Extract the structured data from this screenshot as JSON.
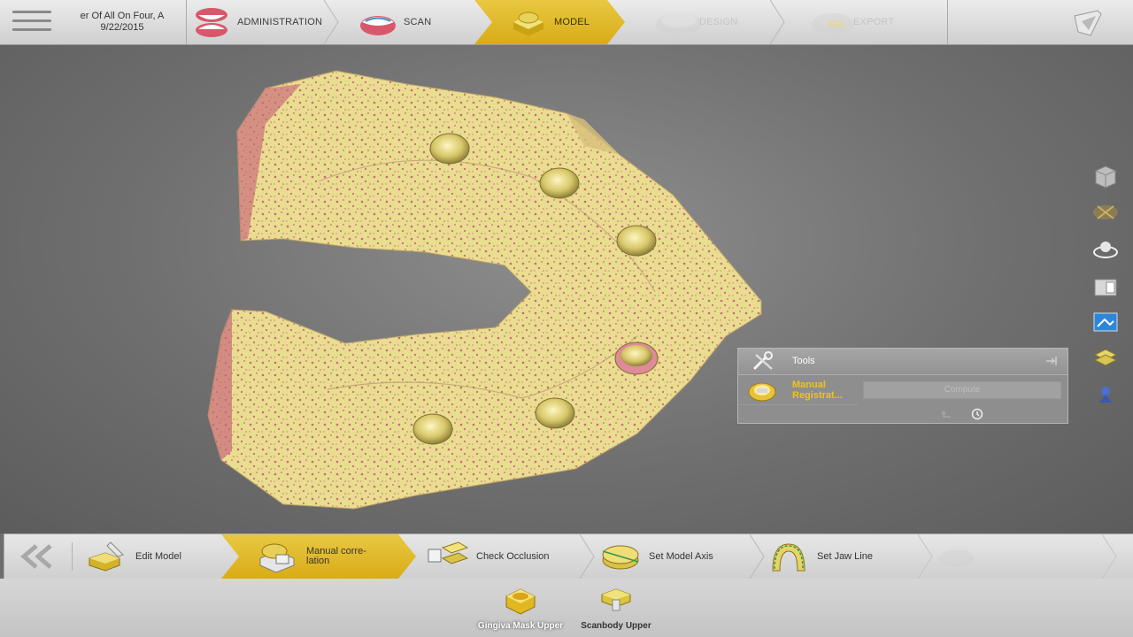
{
  "case": {
    "name": "er Of All On Four, A",
    "date": "9/22/2015"
  },
  "workflow": [
    {
      "label": "ADMINISTRATION",
      "state": "done",
      "icon": "teeth-open-icon"
    },
    {
      "label": "SCAN",
      "state": "done",
      "icon": "teeth-lower-icon"
    },
    {
      "label": "MODEL",
      "state": "active",
      "icon": "model-block-icon"
    },
    {
      "label": "DESIGN",
      "state": "disabled",
      "icon": "crown-design-icon"
    },
    {
      "label": "EXPORT",
      "state": "disabled",
      "icon": "export-icon"
    }
  ],
  "tools_panel": {
    "title": "Tools",
    "tool_label": "Manual\nRegistrat...",
    "compute_label": "Compute"
  },
  "model_steps": [
    {
      "label": "Edit Model",
      "state": "normal",
      "icon": "edit-model-icon"
    },
    {
      "label": "Manual corre-\nlation",
      "state": "active",
      "icon": "manual-correlation-icon"
    },
    {
      "label": "Check Occlusion",
      "state": "normal",
      "icon": "check-occlusion-icon"
    },
    {
      "label": "Set Model Axis",
      "state": "normal",
      "icon": "model-axis-icon"
    },
    {
      "label": "Set Jaw Line",
      "state": "normal",
      "icon": "jaw-line-icon"
    },
    {
      "label": "",
      "state": "disabled",
      "icon": "next-step-icon"
    }
  ],
  "sub_steps": [
    {
      "label": "Gingiva Mask Upper",
      "state": "active",
      "icon": "gingiva-mask-icon"
    },
    {
      "label": "Scanbody Upper",
      "state": "normal",
      "icon": "scanbody-icon"
    }
  ],
  "colors": {
    "accent": "#e2bd2b",
    "model_yellow": "#e8dc8e",
    "model_pink": "#c9697a",
    "panel_gray": "#8e8e8e",
    "tool_orange": "#f0c419"
  }
}
